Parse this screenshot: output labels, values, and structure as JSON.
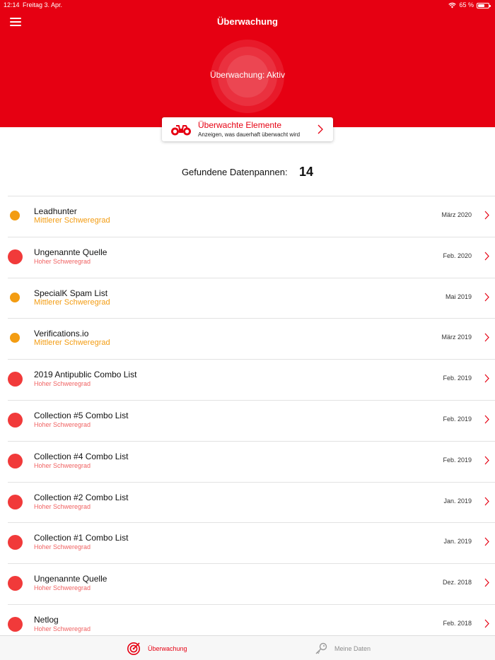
{
  "status_bar": {
    "time": "12:14",
    "date": "Freitag 3. Apr.",
    "battery": "65 %",
    "battery_level": 0.65
  },
  "header": {
    "title": "Überwachung",
    "status": "Überwachung: Aktiv",
    "color": "#e60012"
  },
  "monitor_card": {
    "title": "Überwachte Elemente",
    "subtitle": "Anzeigen, was dauerhaft überwacht wird"
  },
  "breaches": {
    "label": "Gefundene Datenpannen:",
    "count": "14"
  },
  "items": [
    {
      "name": "Leadhunter",
      "severity": "Mittlerer Schweregrad",
      "level": "medium",
      "date": "März 2020"
    },
    {
      "name": "Ungenannte Quelle",
      "severity": "Hoher Schweregrad",
      "level": "high",
      "date": "Feb. 2020"
    },
    {
      "name": "SpecialK Spam List",
      "severity": "Mittlerer Schweregrad",
      "level": "medium",
      "date": "Mai 2019"
    },
    {
      "name": "Verifications.io",
      "severity": "Mittlerer Schweregrad",
      "level": "medium",
      "date": "März 2019"
    },
    {
      "name": "2019 Antipublic Combo List",
      "severity": "Hoher Schweregrad",
      "level": "high",
      "date": "Feb. 2019"
    },
    {
      "name": "Collection #5 Combo List",
      "severity": "Hoher Schweregrad",
      "level": "high",
      "date": "Feb. 2019"
    },
    {
      "name": "Collection #4 Combo List",
      "severity": "Hoher Schweregrad",
      "level": "high",
      "date": "Feb. 2019"
    },
    {
      "name": "Collection #2 Combo List",
      "severity": "Hoher Schweregrad",
      "level": "high",
      "date": "Jan. 2019"
    },
    {
      "name": "Collection #1 Combo List",
      "severity": "Hoher Schweregrad",
      "level": "high",
      "date": "Jan. 2019"
    },
    {
      "name": "Ungenannte Quelle",
      "severity": "Hoher Schweregrad",
      "level": "high",
      "date": "Dez. 2018"
    },
    {
      "name": "Netlog",
      "severity": "Hoher Schweregrad",
      "level": "high",
      "date": "Feb. 2018"
    }
  ],
  "tabs": [
    {
      "label": "Überwachung",
      "icon": "radar-icon",
      "active": true
    },
    {
      "label": "Meine Daten",
      "icon": "key-icon",
      "active": false
    }
  ]
}
